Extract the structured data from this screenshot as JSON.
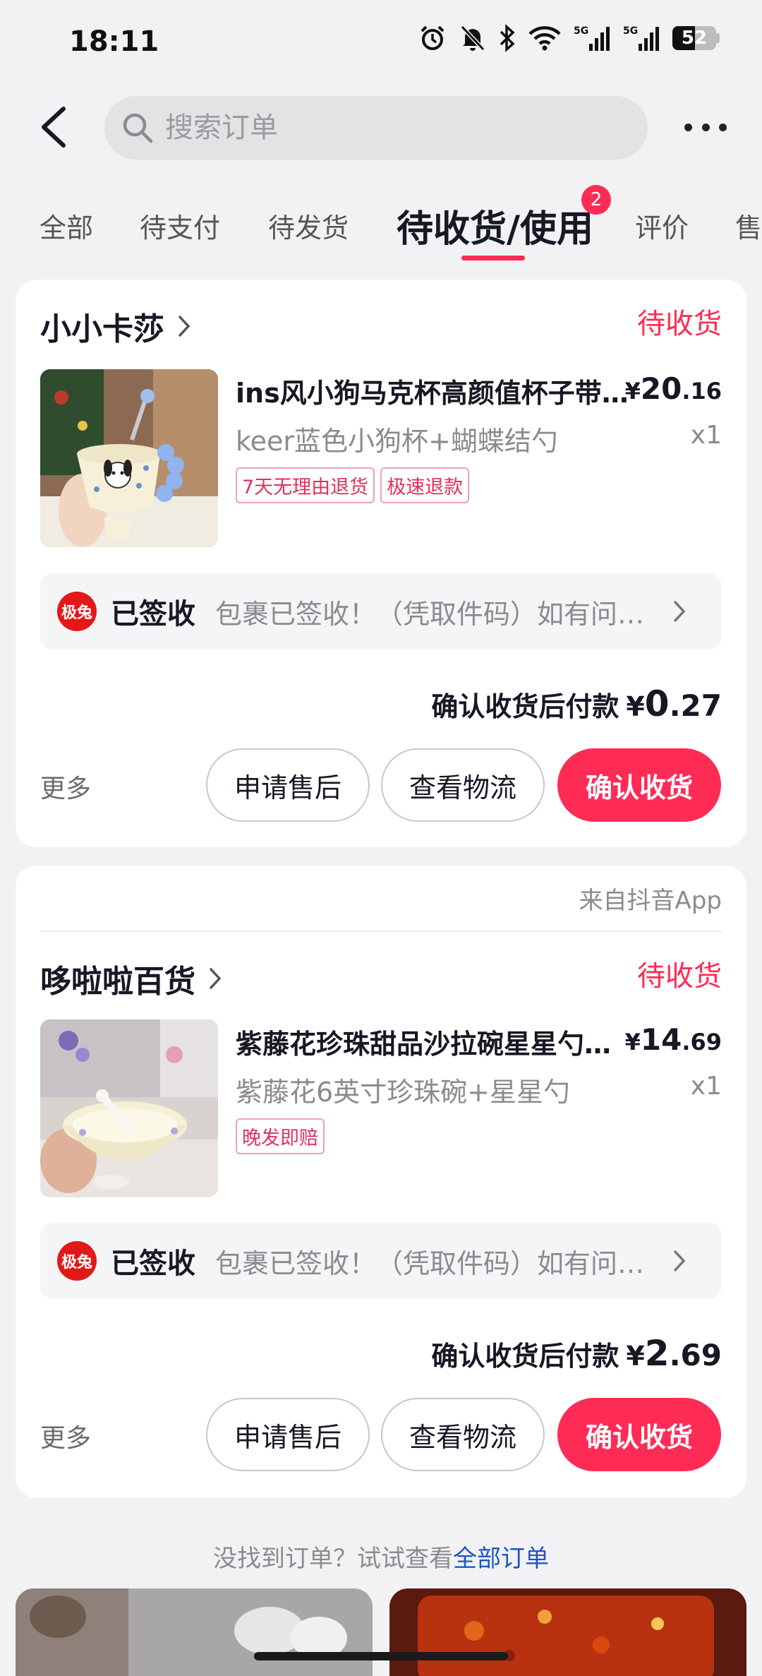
{
  "status_bar": {
    "time": "18:11",
    "icons": [
      "alarm-icon",
      "mute-icon",
      "bluetooth-icon",
      "wifi-icon",
      "signal-5g-icon",
      "signal-5g-icon"
    ],
    "battery": "52",
    "battery_level": 0.52
  },
  "header": {
    "search_placeholder": "搜索订单"
  },
  "tabs": {
    "items": [
      "全部",
      "待支付",
      "待发货",
      "待收货/使用",
      "评价",
      "售"
    ],
    "active": "待收货/使用",
    "badge": "2"
  },
  "orders": [
    {
      "store": "小小卡莎",
      "status": "待收货",
      "product_title": "ins风小狗马克杯高颜值杯子带勺早餐杯",
      "price_symbol": "¥",
      "price_int": "20",
      "price_dec": ".16",
      "spec": "keer蓝色小狗杯+蝴蝶结勺",
      "qty": "x1",
      "tags": [
        "7天无理由退货",
        "极速退款"
      ],
      "carrier_logo": "极兔",
      "logistics_status": "已签收",
      "logistics_desc": "包裹已签收！（凭取件码）如有问题请联系",
      "pay_label": "确认收货后付款",
      "pay_symbol": "¥",
      "pay_int": "0",
      "pay_dec": ".27",
      "more": "更多",
      "btn_after_sale": "申请售后",
      "btn_logistics": "查看物流",
      "btn_confirm": "确认收货"
    },
    {
      "source": "来自抖音App",
      "store": "哆啦啦百货",
      "status": "待收货",
      "product_title": "紫藤花珍珠甜品沙拉碗星星勺套装",
      "price_symbol": "¥",
      "price_int": "14",
      "price_dec": ".69",
      "spec": "紫藤花6英寸珍珠碗+星星勺",
      "qty": "x1",
      "tags": [
        "晚发即赔"
      ],
      "carrier_logo": "极兔",
      "logistics_status": "已签收",
      "logistics_desc": "包裹已签收！（凭取件码）如有问题请联系",
      "pay_label": "确认收货后付款",
      "pay_symbol": "¥",
      "pay_int": "2",
      "pay_dec": ".69",
      "more": "更多",
      "btn_after_sale": "申请售后",
      "btn_logistics": "查看物流",
      "btn_confirm": "确认收货"
    }
  ],
  "footer": {
    "hint": "没找到订单？试试查看",
    "link": "全部订单"
  }
}
